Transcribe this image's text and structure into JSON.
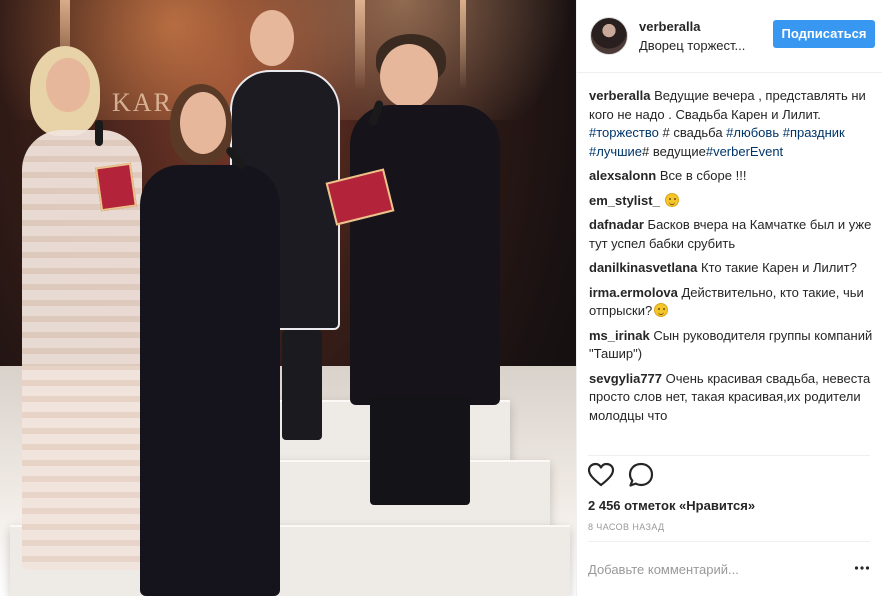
{
  "post": {
    "username": "verberalla",
    "location": "Дворец торжест...",
    "follow_label": "Подписаться",
    "photo_sign": "KAR",
    "caption": {
      "user": "verberalla",
      "text": "Ведущие вечера , представлять ни кого не надо . Свадьба Карен и Лилит.",
      "tag1": "#торжество",
      "plain1": " # свадьба ",
      "tag2": "#любовь",
      "tag3": "#праздник",
      "tag4": "#лучшие",
      "plain2": "# ведущие",
      "tag5": "#verberEvent"
    },
    "comments": [
      {
        "user": "alexsalonn",
        "text": "Все в сборе !!!"
      },
      {
        "user": "em_stylist_",
        "text": ""
      },
      {
        "user": "dafnadar",
        "text": "Басков вчера на Камчатке был и уже тут успел бабки срубить"
      },
      {
        "user": "danilkinasvetlana",
        "text": "Кто такие Карен и Лилит?"
      },
      {
        "user": "irma.ermolova",
        "text": "Действительно, кто такие, чьи отпрыски?"
      },
      {
        "user": "ms_irinak",
        "text": "Сын руководителя группы компаний \"Ташир\")"
      },
      {
        "user": "sevgylia777",
        "text": "Очень красивая свадьба, невеста просто слов нет, такая красивая,их родители молодцы что"
      }
    ],
    "likes": "2 456 отметок «Нравится»",
    "time": "8 часов назад",
    "comment_placeholder": "Добавьте комментарий...",
    "icons": {
      "like": "heart-icon",
      "comment": "comment-icon",
      "more": "more-icon",
      "emoji": "smiley-emoji-icon"
    },
    "colors": {
      "accent": "#3897f0",
      "hashtag": "#003569",
      "muted": "#999999",
      "divider": "#efefef"
    }
  }
}
